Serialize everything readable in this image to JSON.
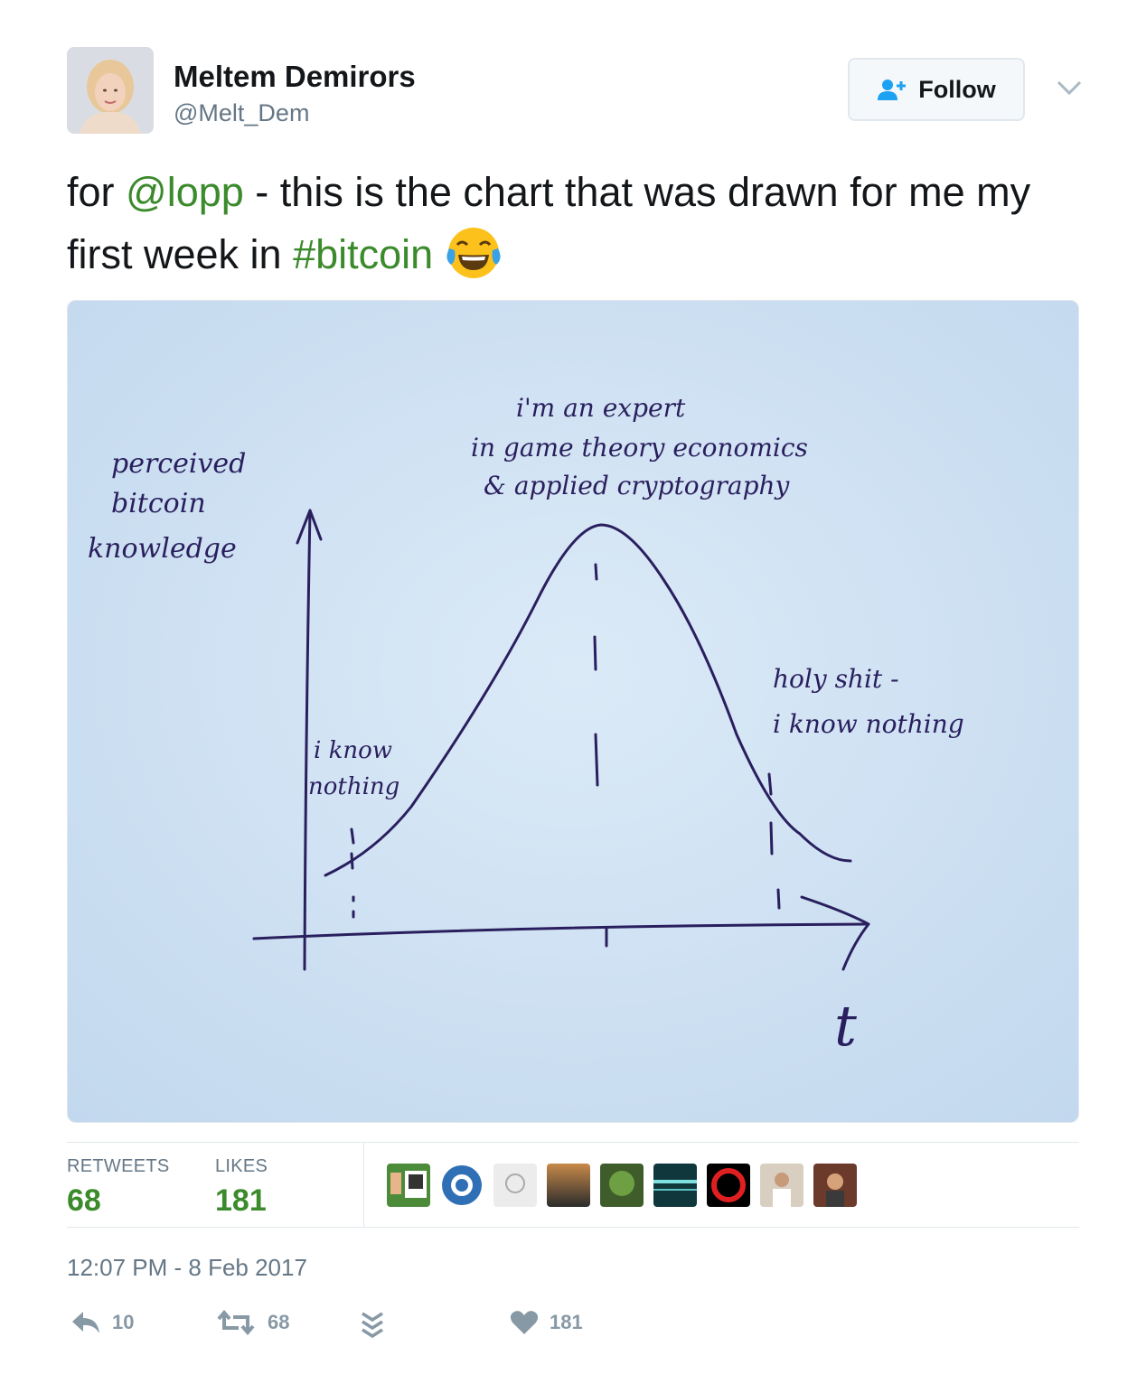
{
  "author": {
    "display_name": "Meltem Demirors",
    "handle": "@Melt_Dem"
  },
  "follow_button": {
    "label": "Follow"
  },
  "tweet": {
    "text_before": "for ",
    "mention": "@lopp",
    "text_middle": " - this is the chart that was drawn for me my first week in ",
    "hashtag": "#bitcoin",
    "emoji": "face-with-tears-of-joy"
  },
  "photo": {
    "y_axis_label": [
      "perceived",
      "bitcoin",
      "knowledge"
    ],
    "peak_label": [
      "i'm an expert",
      "in game theory economics",
      "& applied cryptography"
    ],
    "left_label": [
      "i know",
      "nothing"
    ],
    "right_label": [
      "holy shit -",
      "i know nothing"
    ],
    "x_axis_label": "t"
  },
  "stats": {
    "retweets_label": "RETWEETS",
    "retweets_value": "68",
    "likes_label": "LIKES",
    "likes_value": "181"
  },
  "timestamp": "12:07 PM - 8 Feb 2017",
  "actions": {
    "reply_count": "10",
    "retweet_count": "68",
    "like_count": "181"
  },
  "colors": {
    "link_green": "#3b8a2c",
    "muted": "#657786",
    "border": "#e1e8ed",
    "ink": "#2a1f5e",
    "paper": "#cfe2f3"
  }
}
